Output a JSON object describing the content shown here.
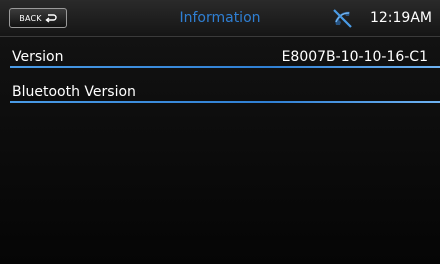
{
  "header": {
    "back_label": "BACK",
    "title": "Information",
    "status_icon": "phone-disconnected-icon",
    "time": "12:19AM"
  },
  "rows": [
    {
      "label": "Version",
      "value": "E8007B-10-10-16-C1"
    },
    {
      "label": "Bluetooth Version",
      "value": ""
    }
  ],
  "colors": {
    "accent": "#2f7fd3",
    "background": "#0a0a0a",
    "text": "#ffffff"
  }
}
